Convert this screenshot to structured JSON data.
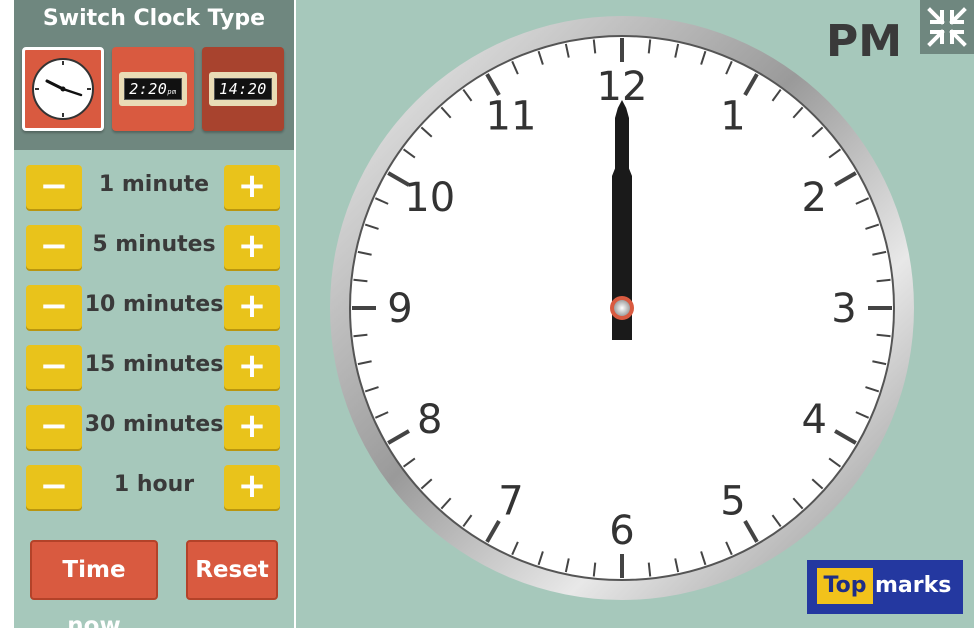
{
  "sidebar": {
    "title": "Switch Clock Type",
    "clock_types": [
      {
        "id": "analog"
      },
      {
        "id": "digital-12h",
        "display": "2:20",
        "suffix": "pm"
      },
      {
        "id": "digital-24h",
        "display": "14:20"
      }
    ],
    "steps": [
      {
        "label": "1 minute"
      },
      {
        "label": "5 minutes"
      },
      {
        "label": "10 minutes"
      },
      {
        "label": "15 minutes"
      },
      {
        "label": "30 minutes"
      },
      {
        "label": "1 hour"
      }
    ],
    "minus_symbol": "−",
    "plus_symbol": "+",
    "time_now_label": "Time now",
    "reset_label": "Reset"
  },
  "clock": {
    "period": "PM",
    "hour": 12,
    "minute": 0,
    "numbers": [
      "12",
      "1",
      "2",
      "3",
      "4",
      "5",
      "6",
      "7",
      "8",
      "9",
      "10",
      "11"
    ]
  },
  "logo": {
    "part1": "Top",
    "part2": "marks"
  },
  "colors": {
    "accent_red": "#d95a40",
    "button_yellow": "#e9c31b",
    "background_green": "#a6c8bb",
    "panel_grey": "#6f877f",
    "logo_blue": "#2438a0"
  },
  "icons": {
    "fullscreen": "fullscreen-collapse-icon"
  }
}
